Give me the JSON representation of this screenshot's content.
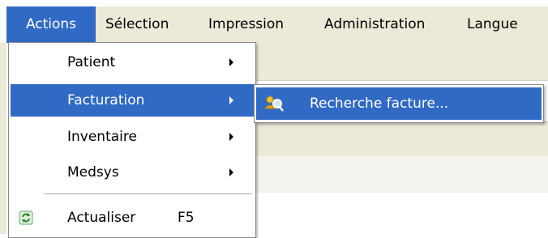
{
  "menubar": {
    "items": [
      {
        "label": "Actions",
        "active": true
      },
      {
        "label": "Sélection",
        "active": false
      },
      {
        "label": "Impression",
        "active": false
      },
      {
        "label": "Administration",
        "active": false
      },
      {
        "label": "Langue",
        "active": false
      }
    ]
  },
  "actions_menu": {
    "items": [
      {
        "label": "Patient",
        "has_submenu": true
      },
      {
        "label": "Facturation",
        "has_submenu": true,
        "active": true
      },
      {
        "label": "Inventaire",
        "has_submenu": true
      },
      {
        "label": "Medsys",
        "has_submenu": true
      },
      {
        "label": "Actualiser",
        "shortcut": "F5",
        "icon": "refresh-icon"
      }
    ]
  },
  "facturation_submenu": {
    "items": [
      {
        "label": "Recherche facture...",
        "icon": "search-person-icon",
        "active": true
      }
    ]
  },
  "colors": {
    "menubar_bg": "#ece9d8",
    "highlight": "#316ac5",
    "highlight_text": "#ffffff",
    "menu_bg": "#ffffff"
  }
}
